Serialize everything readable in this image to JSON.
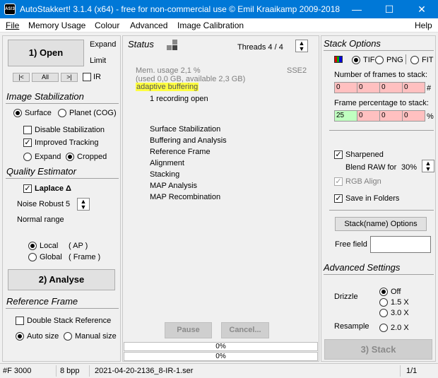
{
  "window": {
    "title": "AutoStakkert! 3.1.4 (x64) - free for non-commercial use © Emil Kraaikamp 2009-2018",
    "logo_text": "AS!3"
  },
  "menu": [
    "File",
    "Memory Usage",
    "Colour",
    "Advanced",
    "Image Calibration",
    "Help"
  ],
  "left": {
    "open_label": "1) Open",
    "expand_label": "Expand",
    "limit_label": "Limit",
    "nav": [
      "|<",
      "All",
      ">|"
    ],
    "ir_label": "IR",
    "stabilization": {
      "header": "Image Stabilization",
      "surface_label": "Surface",
      "planet_label": "Planet (COG)",
      "disable_label": "Disable Stabilization",
      "improved_label": "Improved Tracking",
      "expand_label": "Expand",
      "cropped_label": "Cropped"
    },
    "quality": {
      "header": "Quality Estimator",
      "laplace_label": "Laplace Δ",
      "noise_label": "Noise Robust",
      "noise_value": "5",
      "normal_range": "Normal range",
      "local_label": "Local",
      "local_note": "( AP )",
      "global_label": "Global",
      "global_note": "( Frame )"
    },
    "analyse_label": "2) Analyse",
    "reference": {
      "header": "Reference Frame",
      "double_label": "Double Stack Reference",
      "auto_label": "Auto size",
      "manual_label": "Manual size"
    }
  },
  "center": {
    "status_header": "Status",
    "threads_label": "Threads 4 / 4",
    "mem_usage": "Mem. usage 2,1 %",
    "mem_detail": "(used 0,0 GB, available 2,3 GB)",
    "sse": "SSE2",
    "buffering": "adaptive buffering",
    "recording": "1 recording open",
    "steps": [
      "Surface Stabilization",
      "Buffering and Analysis",
      "Reference Frame",
      "Alignment",
      "Stacking",
      "MAP Analysis",
      "MAP Recombination"
    ],
    "pause_label": "Pause",
    "cancel_label": "Cancel...",
    "progress1": "0%",
    "progress2": "0%",
    "highlight_color": "#ffff40"
  },
  "right": {
    "header": "Stack Options",
    "formats": [
      "TIF",
      "PNG",
      "FIT"
    ],
    "frames_label": "Number of frames to stack:",
    "frames_values": [
      "0",
      "0",
      "0",
      "0"
    ],
    "frames_unit": "#",
    "pct_label": "Frame percentage to stack:",
    "pct_values": [
      "25",
      "0",
      "0",
      "0"
    ],
    "pct_unit": "%",
    "sharpened_label": "Sharpened",
    "blend_label": "Blend RAW for",
    "blend_value": "30%",
    "rgb_label": "RGB Align",
    "save_folders_label": "Save in Folders",
    "stackname_label": "Stack(name) Options",
    "free_field_label": "Free field",
    "advanced_header": "Advanced Settings",
    "drizzle_label": "Drizzle",
    "drizzle_options": [
      "Off",
      "1.5 X",
      "3.0 X"
    ],
    "resample_label": "Resample",
    "resample_option": "2.0 X",
    "stack_label": "3) Stack"
  },
  "statusbar": {
    "frames": "#F 3000",
    "bpp": "8 bpp",
    "file": "2021-04-20-2136_8-IR-1.ser",
    "page": "1/1"
  }
}
